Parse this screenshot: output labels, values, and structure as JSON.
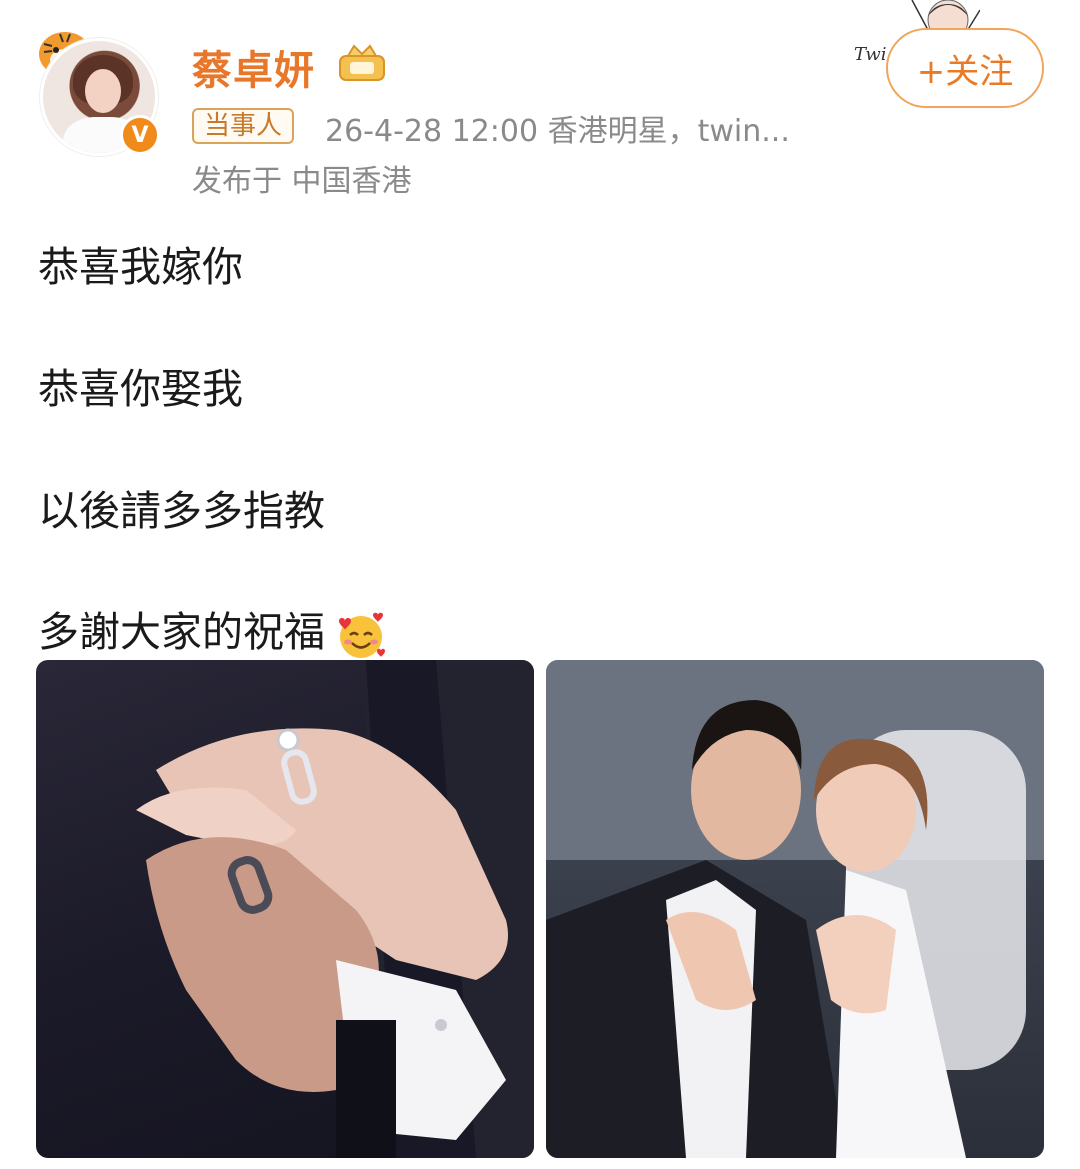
{
  "post": {
    "username": "蔡卓妍",
    "tag": "当事人",
    "meta_line": "26-4-28 12:00  香港明星，twin...",
    "published_location": "发布于 中国香港",
    "follow_label": "+关注",
    "lines": [
      "恭喜我嫁你",
      "恭喜你娶我",
      "以後請多多指教",
      "多謝大家的祝福"
    ],
    "sticker_text": "Twi"
  },
  "icons": {
    "verified": "verified-v-icon",
    "vip": "vip-crown-badge-icon",
    "emoji": "smiling-face-with-hearts-emoji"
  },
  "colors": {
    "accent": "#e8772a",
    "meta": "#8a8a8a",
    "verified": "#f08a1b"
  }
}
